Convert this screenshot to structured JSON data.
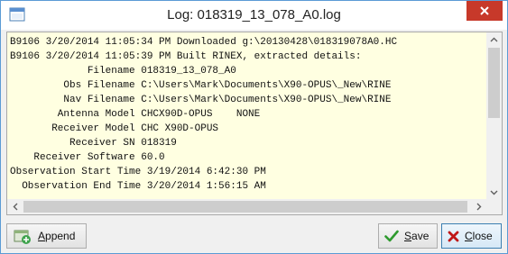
{
  "window": {
    "title": "Log: 018319_13_078_A0.log",
    "close_glyph": "✕"
  },
  "log": {
    "lines": [
      "B9106 3/20/2014 11:05:34 PM Downloaded g:\\20130428\\018319078A0.HC",
      "B9106 3/20/2014 11:05:39 PM Built RINEX, extracted details:",
      "             Filename 018319_13_078_A0",
      "         Obs Filename C:\\Users\\Mark\\Documents\\X90-OPUS\\_New\\RINE",
      "         Nav Filename C:\\Users\\Mark\\Documents\\X90-OPUS\\_New\\RINE",
      "        Antenna Model CHCX90D-OPUS    NONE",
      "       Receiver Model CHC X90D-OPUS",
      "          Receiver SN 018319",
      "    Receiver Software 60.0",
      "Observation Start Time 3/19/2014 6:42:30 PM",
      "  Observation End Time 3/20/2014 1:56:15 AM"
    ]
  },
  "buttons": {
    "append_label": "Append",
    "save_label": "Save",
    "close_label": "Close"
  },
  "icons": {
    "app": "window-app-icon",
    "append": "append-document-icon",
    "save": "green-checkmark-icon",
    "close": "red-x-icon"
  },
  "colors": {
    "log_background": "#ffffe1",
    "close_button": "#c7392a",
    "window_border": "#5b9bd5"
  }
}
